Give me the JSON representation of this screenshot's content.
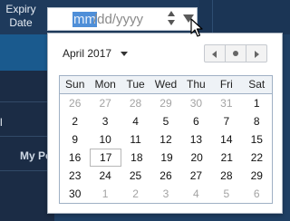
{
  "form": {
    "label": "Expiry Date",
    "date_input": {
      "month_seg": "mm",
      "rest": "/dd/yyyy"
    }
  },
  "background": {
    "mark": "l",
    "partial_text": "My Po"
  },
  "calendar": {
    "month_label": "April 2017",
    "weekdays": [
      "Sun",
      "Mon",
      "Tue",
      "Wed",
      "Thu",
      "Fri",
      "Sat"
    ],
    "weeks": [
      [
        {
          "d": "26",
          "o": true
        },
        {
          "d": "27",
          "o": true
        },
        {
          "d": "28",
          "o": true
        },
        {
          "d": "29",
          "o": true
        },
        {
          "d": "30",
          "o": true
        },
        {
          "d": "31",
          "o": true
        },
        {
          "d": "1"
        }
      ],
      [
        {
          "d": "2"
        },
        {
          "d": "3"
        },
        {
          "d": "4"
        },
        {
          "d": "5"
        },
        {
          "d": "6"
        },
        {
          "d": "7"
        },
        {
          "d": "8"
        }
      ],
      [
        {
          "d": "9"
        },
        {
          "d": "10"
        },
        {
          "d": "11"
        },
        {
          "d": "12"
        },
        {
          "d": "13"
        },
        {
          "d": "14"
        },
        {
          "d": "15"
        }
      ],
      [
        {
          "d": "16"
        },
        {
          "d": "17",
          "today": true
        },
        {
          "d": "18"
        },
        {
          "d": "19"
        },
        {
          "d": "20"
        },
        {
          "d": "21"
        },
        {
          "d": "22"
        }
      ],
      [
        {
          "d": "23"
        },
        {
          "d": "24"
        },
        {
          "d": "25"
        },
        {
          "d": "26"
        },
        {
          "d": "27"
        },
        {
          "d": "28"
        },
        {
          "d": "29"
        }
      ],
      [
        {
          "d": "30"
        },
        {
          "d": "1",
          "o": true
        },
        {
          "d": "2",
          "o": true
        },
        {
          "d": "3",
          "o": true
        },
        {
          "d": "4",
          "o": true
        },
        {
          "d": "5",
          "o": true
        },
        {
          "d": "6",
          "o": true
        }
      ]
    ],
    "nav_icons": [
      "chevron-left-icon",
      "dot-icon",
      "chevron-right-icon"
    ]
  },
  "colors": {
    "selection": "#4f8fd8",
    "background": "#1f3f63",
    "grid_border": "#9fb0c4",
    "other_month_text": "#a3a3a3"
  }
}
